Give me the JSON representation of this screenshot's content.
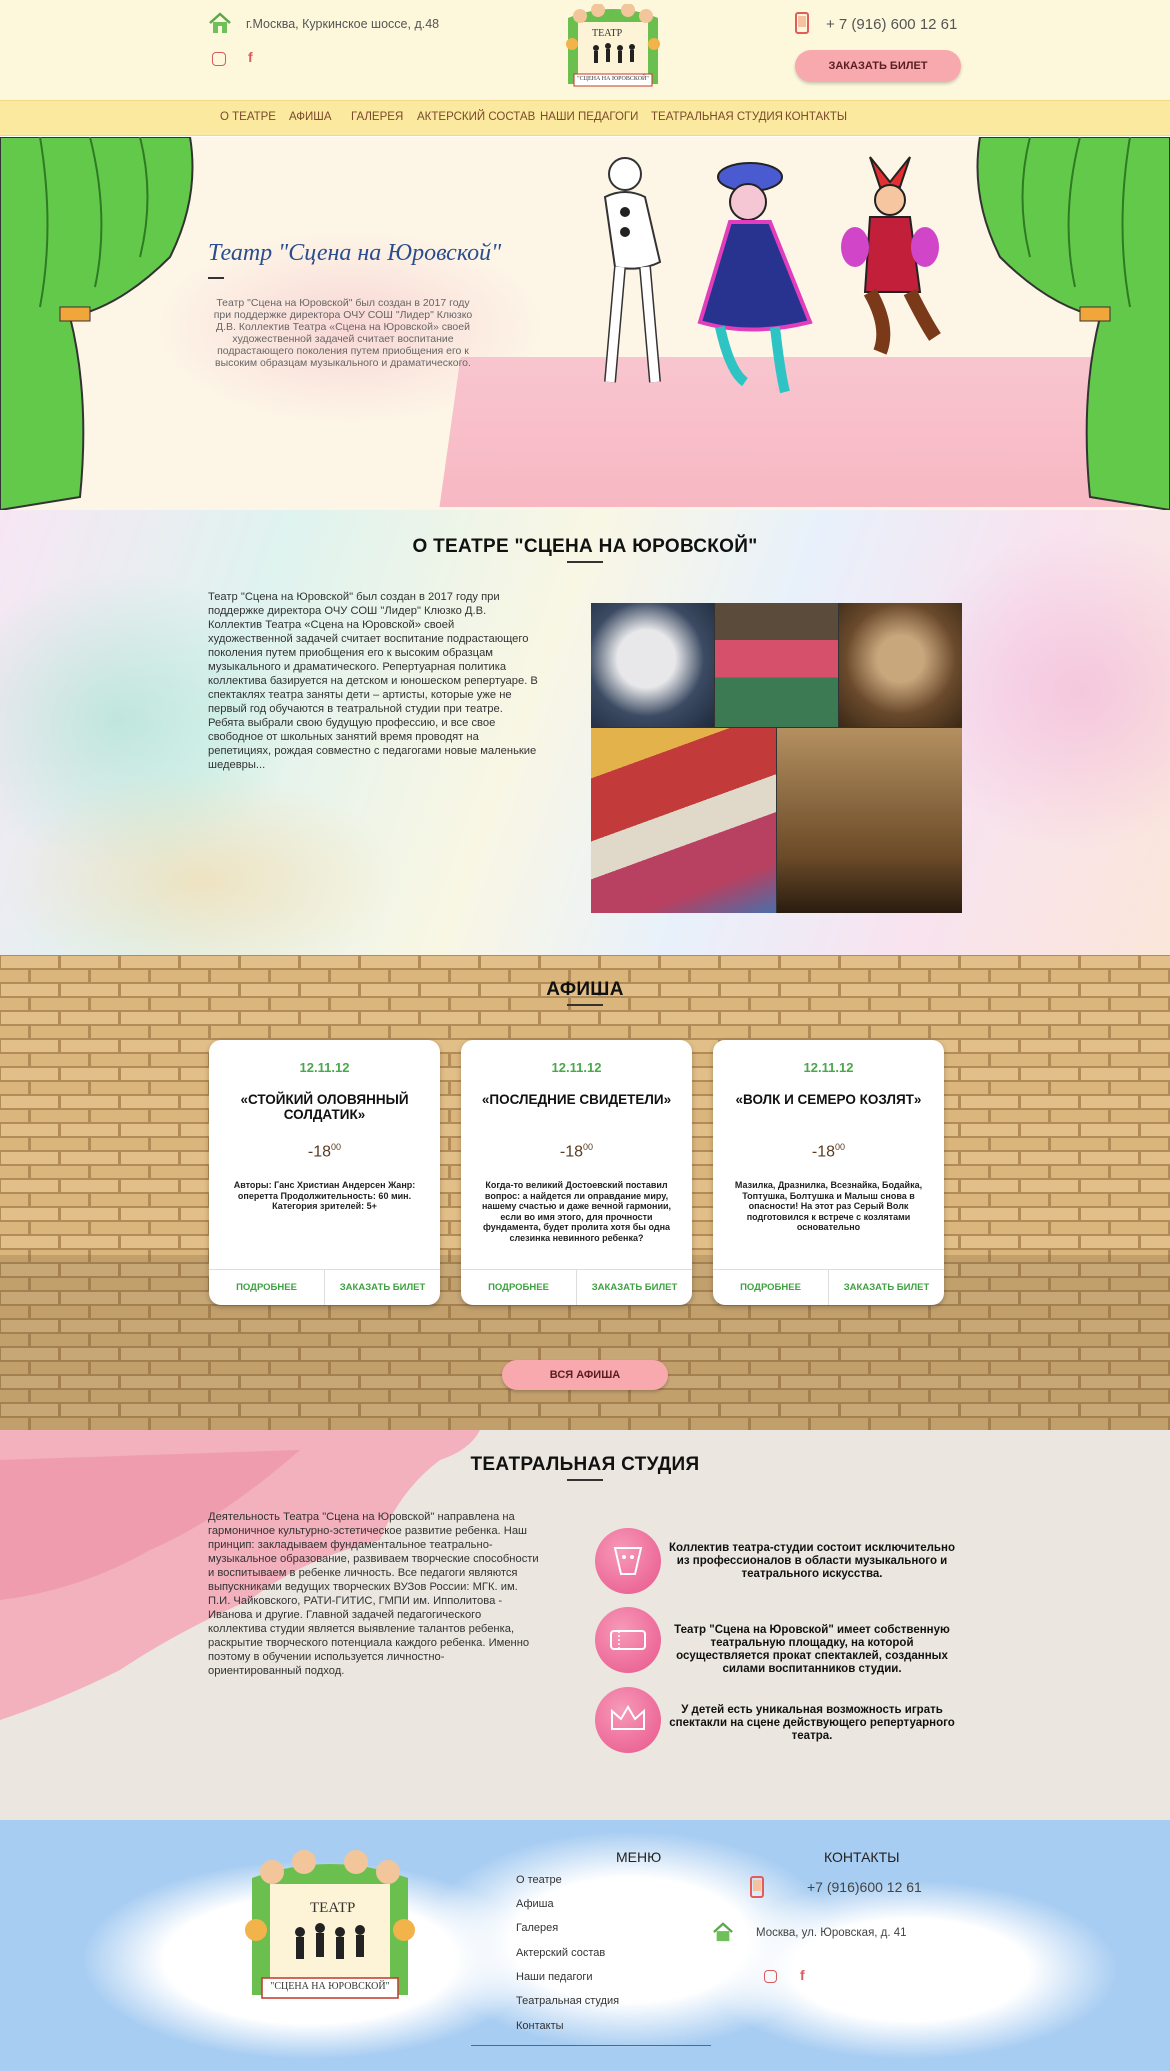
{
  "header": {
    "address": "г.Москва, Куркинское шоссе, д.48",
    "phone": "+ 7 (916) 600 12 61",
    "order_button": "ЗАКАЗАТЬ БИЛЕТ",
    "logo_top": "ТЕАТР",
    "logo_bottom": "\"СЦЕНА НА ЮРОВСКОЙ\""
  },
  "nav": {
    "items": [
      "О ТЕАТРЕ",
      "АФИША",
      "ГАЛЕРЕЯ",
      "АКТЕРСКИЙ СОСТАВ",
      "НАШИ ПЕДАГОГИ",
      "ТЕАТРАЛЬНАЯ СТУДИЯ",
      "КОНТАКТЫ"
    ]
  },
  "hero": {
    "title": "Театр \"Сцена на Юровской\"",
    "text": "Театр \"Сцена на Юровской\" был создан в 2017 году при поддержке директора ОЧУ СОШ \"Лидер\" Клюзко Д.В. Коллектив Театра «Сцена на Юровской» своей художественной задачей считает воспитание подрастающего поколения путем приобщения его к высоким образцам музыкального и драматического."
  },
  "about": {
    "title": "О ТЕАТРЕ \"СЦЕНА НА ЮРОВСКОЙ\"",
    "text": "Театр \"Сцена на Юровской\" был создан в 2017 году при поддержке директора ОЧУ СОШ \"Лидер\" Клюзко Д.В. Коллектив Театра «Сцена на Юровской» своей художественной задачей считает воспитание подрастающего поколения путем приобщения его к высоким образцам музыкального и драматического. Репертуарная политика коллектива базируется на детском и юношеском репертуаре. В спектаклях театра заняты дети – артисты, которые уже не первый год обучаются в театральной студии при театре. Ребята выбрали свою будущую профессию, и все свое свободное от школьных занятий время проводят на репетициях, рождая совместно с педагогами новые маленькие шедевры..."
  },
  "afisha": {
    "title": "АФИША",
    "all_button": "ВСЯ АФИША",
    "cards": [
      {
        "date": "12.11.12",
        "title": "«СТОЙКИЙ ОЛОВЯННЫЙ СОЛДАТИК»",
        "age": "-18",
        "age_sup": "00",
        "desc": "Авторы: Ганс Христиан Андерсен Жанр: оперетта Продолжительность: 60 мин. Категория зрителей: 5+",
        "more": "ПОДРОБНЕЕ",
        "order": "ЗАКАЗАТЬ БИЛЕТ"
      },
      {
        "date": "12.11.12",
        "title": "«ПОСЛЕДНИЕ СВИДЕТЕЛИ»",
        "age": "-18",
        "age_sup": "00",
        "desc": "Когда-то великий Достоевский поставил вопрос: а найдется ли оправдание миру, нашему счастью и даже вечной гармонии, если во имя этого, для прочности фундамента, будет пролита хотя бы одна слезинка невинного ребенка?",
        "more": "ПОДРОБНЕЕ",
        "order": "ЗАКАЗАТЬ БИЛЕТ"
      },
      {
        "date": "12.11.12",
        "title": "«ВОЛК И СЕМЕРО КОЗЛЯТ»",
        "age": "-18",
        "age_sup": "00",
        "desc": "Мазилка, Дразнилка, Всезнайка, Бодайка, Топтушка, Болтушка и Малыш снова в опасности! На этот раз Серый Волк подготовился к встрече с козлятами основательно",
        "more": "ПОДРОБНЕЕ",
        "order": "ЗАКАЗАТЬ БИЛЕТ"
      }
    ]
  },
  "studio": {
    "title": "ТЕАТРАЛЬНАЯ СТУДИЯ",
    "text": "Деятельность Театра \"Сцена на Юровской\" направлена на гармоничное культурно-эстетическое развитие ребенка. Наш принцип: закладываем фундаментальное театрально-музыкальное образование, развиваем творческие способности и воспитываем в ребенке личность. Все педагоги являются выпускниками ведущих творческих ВУЗов России: МГК. им. П.И. Чайковского, РАТИ-ГИТИС, ГМПИ им. Ипполитова - Иванова и другие. Главной задачей педагогического коллектива студии является выявление талантов ребенка, раскрытие творческого потенциала каждого ребенка. Именно поэтому в обучении используется личностно- ориентированный подход.",
    "features": [
      "Коллектив театра-студии состоит исключительно из профессионалов в области музыкального и театрального искусства.",
      "Театр \"Сцена на Юровской\" имеет собственную театральную площадку, на которой осуществляется прокат спектаклей, созданных силами воспитанников студии.",
      "У детей есть уникальная возможность играть спектакли на сцене действующего репертуарного театра."
    ]
  },
  "footer": {
    "menu_title": "МЕНЮ",
    "menu": [
      "О театре",
      "Афиша",
      "Галерея",
      "Актерский состав",
      "Наши педагоги",
      "Театральная студия",
      "Контакты"
    ],
    "contacts_title": "КОНТАКТЫ",
    "phone": "+7 (916)600 12 61",
    "address": "Москва, ул. Юровская, д. 41",
    "logo_top": "ТЕАТР",
    "logo_bottom": "\"СЦЕНА НА ЮРОВСКОЙ\""
  },
  "colors": {
    "accent_pink": "#f7a9ad",
    "green": "#4aa84a",
    "nav_bg": "#fbe9a0",
    "brown": "#7a4a2a"
  }
}
